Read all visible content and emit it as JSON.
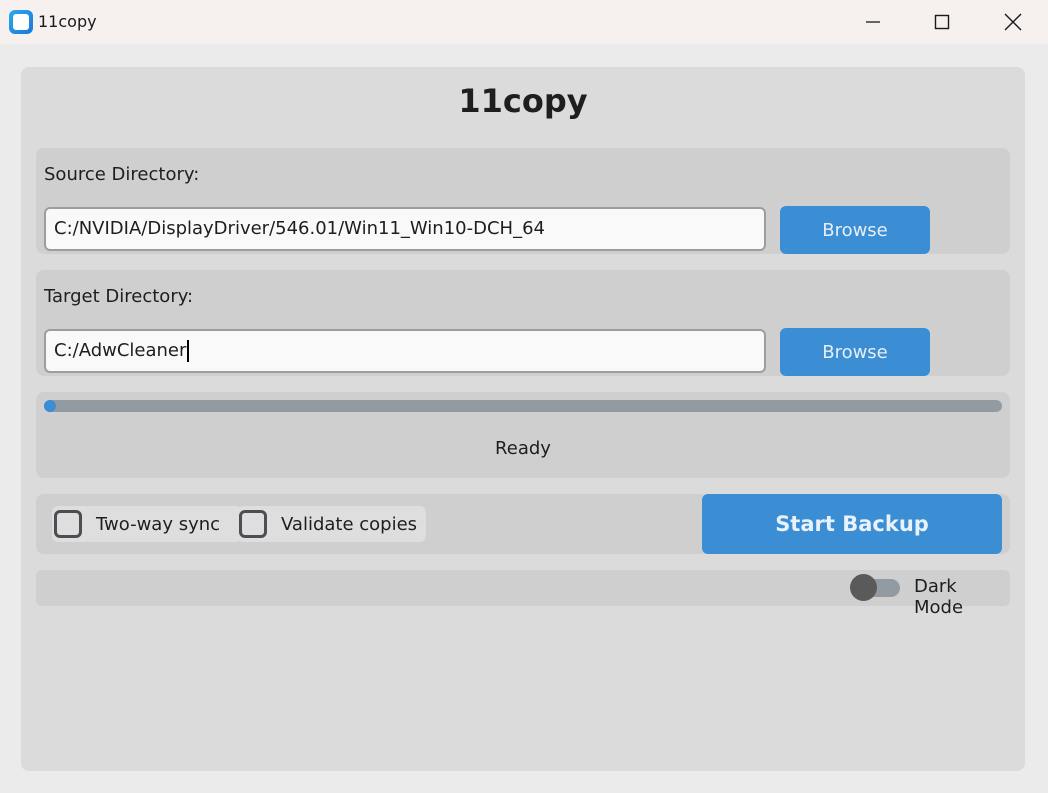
{
  "window": {
    "title": "11copy",
    "icon": "app-icon",
    "controls": [
      "minimize-icon",
      "maximize-icon",
      "close-icon"
    ]
  },
  "heading": "11copy",
  "source": {
    "label": "Source Directory:",
    "value": "C:/NVIDIA/DisplayDriver/546.01/Win11_Win10-DCH_64",
    "browse_label": "Browse"
  },
  "target": {
    "label": "Target Directory:",
    "value": "C:/AdwCleaner",
    "browse_label": "Browse"
  },
  "progress": {
    "value": 0,
    "status": "Ready"
  },
  "options": {
    "two_way_sync": {
      "label": "Two-way sync",
      "checked": false
    },
    "validate_copies": {
      "label": "Validate copies",
      "checked": false
    },
    "start_label": "Start Backup"
  },
  "theme": {
    "dark_mode_label": "Dark Mode",
    "dark_mode_on": false
  },
  "colors": {
    "accent": "#3b8ed4",
    "panel": "#cfcfcf",
    "card": "#dbdbdb"
  }
}
